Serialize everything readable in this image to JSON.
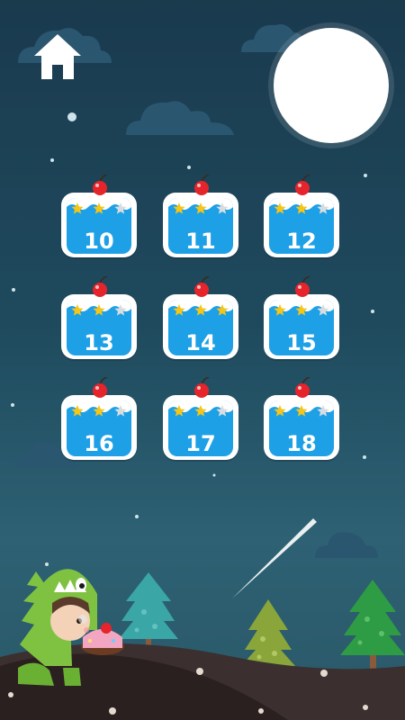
{
  "screen": {
    "home_icon": "home-icon",
    "colors": {
      "sky_top": "#1a3a4e",
      "sky_bottom": "#2d6173",
      "tile_blue": "#1ea0e6",
      "star_gold": "#f5c518",
      "star_empty": "#d9dde0",
      "cherry": "#e6242b",
      "moon": "#ffffff"
    }
  },
  "levels": [
    {
      "number": "10",
      "stars": 2
    },
    {
      "number": "11",
      "stars": 2
    },
    {
      "number": "12",
      "stars": 2
    },
    {
      "number": "13",
      "stars": 2
    },
    {
      "number": "14",
      "stars": 3
    },
    {
      "number": "15",
      "stars": 2
    },
    {
      "number": "16",
      "stars": 2
    },
    {
      "number": "17",
      "stars": 2
    },
    {
      "number": "18",
      "stars": 2
    }
  ]
}
